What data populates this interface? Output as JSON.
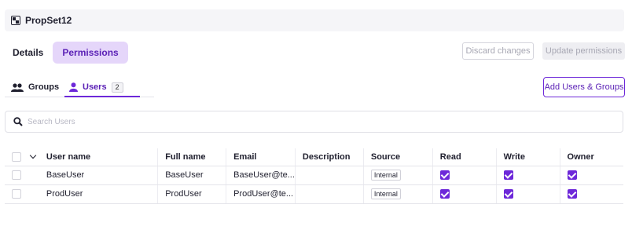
{
  "title": "PropSet12",
  "tabs": [
    {
      "label": "Details"
    },
    {
      "label": "Permissions"
    }
  ],
  "actions": {
    "discard_label": "Discard changes",
    "update_label": "Update permissions",
    "add_label": "Add Users & Groups"
  },
  "subtabs": {
    "groups_label": "Groups",
    "users_label": "Users",
    "users_count": "2"
  },
  "search": {
    "placeholder": "Search Users",
    "value": ""
  },
  "table": {
    "headers": {
      "user_name": "User name",
      "full_name": "Full name",
      "email": "Email",
      "description": "Description",
      "source": "Source",
      "read": "Read",
      "write": "Write",
      "owner": "Owner"
    },
    "rows": [
      {
        "user_name": "BaseUser",
        "full_name": "BaseUser",
        "email": "BaseUser@te...",
        "description": "",
        "source": "Internal",
        "read": true,
        "write": true,
        "owner": true
      },
      {
        "user_name": "ProdUser",
        "full_name": "ProdUser",
        "email": "ProdUser@te...",
        "description": "",
        "source": "Internal",
        "read": true,
        "write": true,
        "owner": true
      }
    ]
  },
  "colors": {
    "accent": "#6d28d9",
    "accent_light": "#e5d6fa"
  },
  "icons": {
    "title": "propset-icon",
    "groups": "groups-icon",
    "users": "user-icon",
    "search": "search-icon",
    "sort": "chevron-down-icon",
    "check": "checkbox-checked-icon"
  }
}
